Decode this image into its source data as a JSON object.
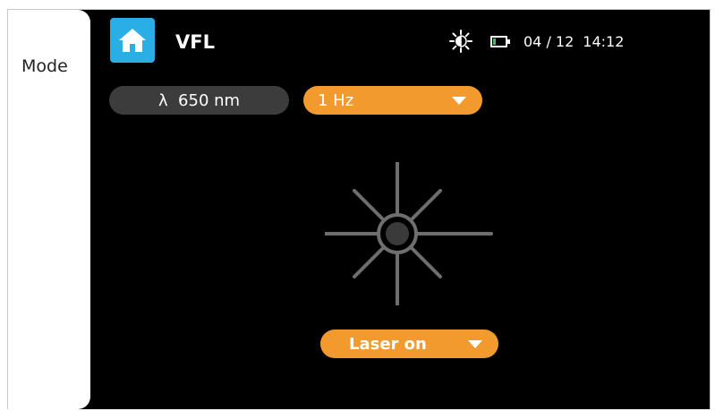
{
  "sidebar": {
    "mode_label": "Mode"
  },
  "header": {
    "home_icon": "home-icon",
    "title": "VFL",
    "status": {
      "brightness_icon": "brightness-icon",
      "battery_icon": "battery-icon",
      "battery_level": 0.2,
      "date": "04 / 12",
      "time": "14:12"
    }
  },
  "controls": {
    "wavelength": "λ  650 nm",
    "frequency": {
      "selected": "1 Hz"
    },
    "laser": {
      "selected": "Laser on"
    }
  },
  "graphic": {
    "icon": "laser-emitter-icon"
  },
  "colors": {
    "background": "#000000",
    "accent_orange": "#f29a2e",
    "home_blue": "#29aee6",
    "pill_gray": "#3c3c3c",
    "laser_gray": "#6e6e6e",
    "battery_green": "#3fc24a"
  }
}
